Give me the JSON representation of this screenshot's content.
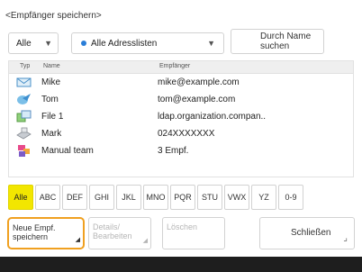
{
  "title": "<Empfänger speichern>",
  "filter": {
    "value": "Alle"
  },
  "address_list": {
    "value": "Alle Adresslisten"
  },
  "search_button": {
    "label_line1": "Durch Name",
    "label_line2": "suchen"
  },
  "table": {
    "headers": {
      "type": "Typ",
      "name": "Name",
      "recipient": "Empfänger"
    },
    "rows": [
      {
        "icon": "email-icon",
        "name": "Mike",
        "recipient": "mike@example.com"
      },
      {
        "icon": "internet-fax-icon",
        "name": "Tom",
        "recipient": "tom@example.com"
      },
      {
        "icon": "file-icon",
        "name": "File 1",
        "recipient": "ldap.organization.compan.."
      },
      {
        "icon": "fax-icon",
        "name": "Mark",
        "recipient": "024XXXXXXX"
      },
      {
        "icon": "group-icon",
        "name": "Manual team",
        "recipient": "3 Empf."
      }
    ]
  },
  "tabs": [
    "Alle",
    "ABC",
    "DEF",
    "GHI",
    "JKL",
    "MNO",
    "PQR",
    "STU",
    "VWX",
    "YZ",
    "0-9"
  ],
  "actions": {
    "new_line1": "Neue Empf.",
    "new_line2": "speichern",
    "details_line1": "Details/",
    "details_line2": "Bearbeiten",
    "delete": "Löschen",
    "close": "Schließen"
  },
  "colors": {
    "active_tab": "#f2e600",
    "focus_outline": "#f0a020",
    "accent": "#2a7ed8"
  }
}
